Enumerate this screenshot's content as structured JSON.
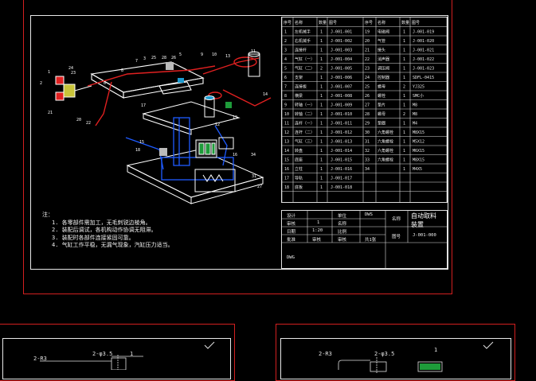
{
  "bom": {
    "headers": [
      "序号",
      "名称",
      "数量",
      "图号",
      "序号",
      "名称",
      "数量",
      "图号"
    ],
    "left": [
      {
        "no": "1",
        "name": "左机械手",
        "qty": "1",
        "code": "J-001-001"
      },
      {
        "no": "2",
        "name": "右机械手",
        "qty": "1",
        "code": "J-001-002"
      },
      {
        "no": "3",
        "name": "连接杆",
        "qty": "1",
        "code": "J-001-003"
      },
      {
        "no": "4",
        "name": "气缸（一）",
        "qty": "1",
        "code": "J-001-004"
      },
      {
        "no": "5",
        "name": "气缸（二）",
        "qty": "2",
        "code": "J-001-005"
      },
      {
        "no": "6",
        "name": "支架",
        "qty": "1",
        "code": "J-001-006"
      },
      {
        "no": "7",
        "name": "连接板",
        "qty": "1",
        "code": "J-001-007"
      },
      {
        "no": "8",
        "name": "横梁",
        "qty": "1",
        "code": "J-001-008"
      },
      {
        "no": "9",
        "name": "转轴（一）",
        "qty": "1",
        "code": "J-001-009"
      },
      {
        "no": "10",
        "name": "转轴（二）",
        "qty": "1",
        "code": "J-001-010"
      },
      {
        "no": "11",
        "name": "连杆（一）",
        "qty": "1",
        "code": "J-001-011"
      },
      {
        "no": "12",
        "name": "连杆（二）",
        "qty": "1",
        "code": "J-001-012"
      },
      {
        "no": "13",
        "name": "气缸（三）",
        "qty": "1",
        "code": "J-001-013"
      },
      {
        "no": "14",
        "name": "转盘",
        "qty": "1",
        "code": "J-001-014"
      },
      {
        "no": "15",
        "name": "底座",
        "qty": "1",
        "code": "J-001-015"
      },
      {
        "no": "16",
        "name": "立柱",
        "qty": "1",
        "code": "J-001-016"
      },
      {
        "no": "17",
        "name": "导轨",
        "qty": "1",
        "code": "J-001-017"
      },
      {
        "no": "18",
        "name": "底板",
        "qty": "1",
        "code": "J-001-018"
      }
    ],
    "right": [
      {
        "no": "19",
        "name": "电磁阀",
        "qty": "1",
        "code": "J-001-019"
      },
      {
        "no": "20",
        "name": "气管",
        "qty": "1",
        "code": "J-001-020"
      },
      {
        "no": "21",
        "name": "接头",
        "qty": "1",
        "code": "J-001-021"
      },
      {
        "no": "22",
        "name": "消声器",
        "qty": "1",
        "code": "J-001-022"
      },
      {
        "no": "23",
        "name": "调压阀",
        "qty": "1",
        "code": "J-001-023"
      },
      {
        "no": "24",
        "name": "控制器",
        "qty": "1",
        "code": "SDFL-0415"
      },
      {
        "no": "25",
        "name": "螺母",
        "qty": "2",
        "code": "YJ325"
      },
      {
        "no": "26",
        "name": "螺栓",
        "qty": "1",
        "code": "SMC小"
      },
      {
        "no": "27",
        "name": "垫片",
        "qty": "1",
        "code": "M8"
      },
      {
        "no": "28",
        "name": "螺母",
        "qty": "2",
        "code": "M8"
      },
      {
        "no": "29",
        "name": "垫圈",
        "qty": "1",
        "code": "M4"
      },
      {
        "no": "30",
        "name": "六角螺栓",
        "qty": "1",
        "code": "M8X15"
      },
      {
        "no": "31",
        "name": "六角螺栓",
        "qty": "1",
        "code": "M5X12"
      },
      {
        "no": "32",
        "name": "六角螺栓",
        "qty": "1",
        "code": "M6X15"
      },
      {
        "no": "33",
        "name": "六角螺栓",
        "qty": "1",
        "code": "M8X15"
      },
      {
        "no": "34",
        "name": "",
        "qty": "1",
        "code": "M4X5"
      }
    ]
  },
  "notes": {
    "title": "注：",
    "items": [
      "1.  各零部件需加工，无毛刺锐边棱角。",
      "2.  装配后调试，各机构动作协调无阻滞。",
      "3.  装配时各部件连接紧固可靠。",
      "4.  气缸工作平稳，无漏气现象，汽缸压力适当。"
    ]
  },
  "titleblock": {
    "design": "设计",
    "design_qty": "1",
    "unit": "单位",
    "unit_val": "DWS",
    "check": "审核",
    "check_val": "1",
    "material": "名称",
    "date": "日期",
    "date_val": "1:20",
    "scale": "比例",
    "approve": "批准",
    "approve_val": "审核",
    "sheet": "审核",
    "sheet_val": "共1张",
    "name_label": "名称",
    "name": "自动取料\n装置",
    "code_label": "图号",
    "code": "J-001-000",
    "corner": "DWG"
  },
  "dims": {
    "a1": "2-R3",
    "a2": "2-φ3.5",
    "a3": "1",
    "b1": "2-R3",
    "b2": "2-φ3.5",
    "b3": "1"
  },
  "callouts": [
    "1",
    "24",
    "2",
    "21",
    "23",
    "7",
    "3",
    "25",
    "28",
    "26",
    "5",
    "9",
    "10",
    "13",
    "11",
    "8",
    "12",
    "14",
    "17",
    "20",
    "22",
    "19",
    "15",
    "18",
    "16",
    "34",
    "31",
    "27"
  ]
}
